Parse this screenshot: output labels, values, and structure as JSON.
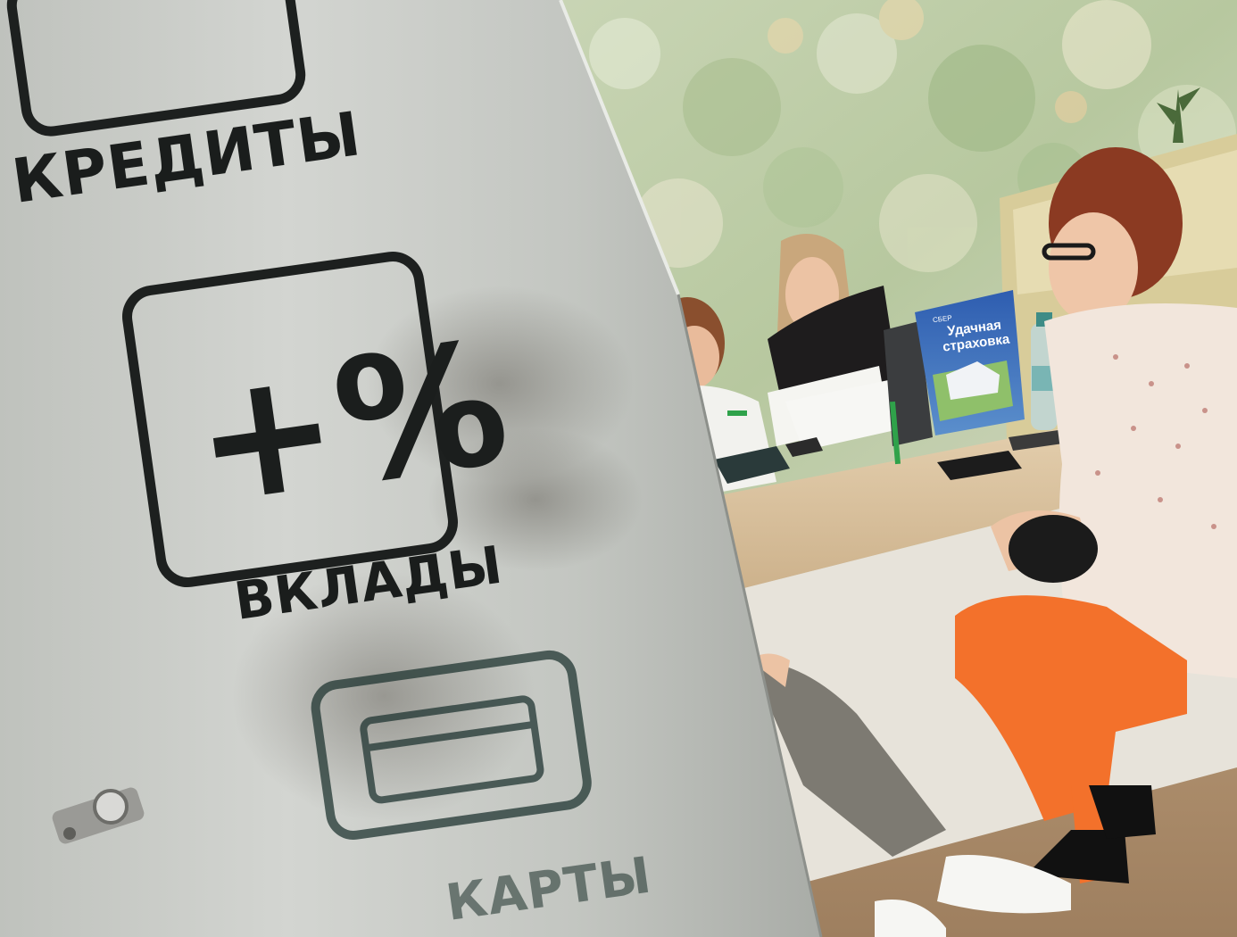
{
  "photo": {
    "alt": "",
    "sign": {
      "credits_label": "КРЕДИТЫ",
      "percent_label": "+%",
      "deposits_label": "ВКЛАДЫ",
      "cards_label": "КАРТЫ"
    },
    "poster": {
      "brand": "СБЕР",
      "title": "Удачная страховка"
    },
    "colors": {
      "glass": "#b9bbb6",
      "wall_green": "#b8c8a4",
      "desk": "#dcc6a6",
      "orange_pants": "#f2722c",
      "poster_blue": "#2a5aa8",
      "sber_green": "#21a038"
    }
  }
}
